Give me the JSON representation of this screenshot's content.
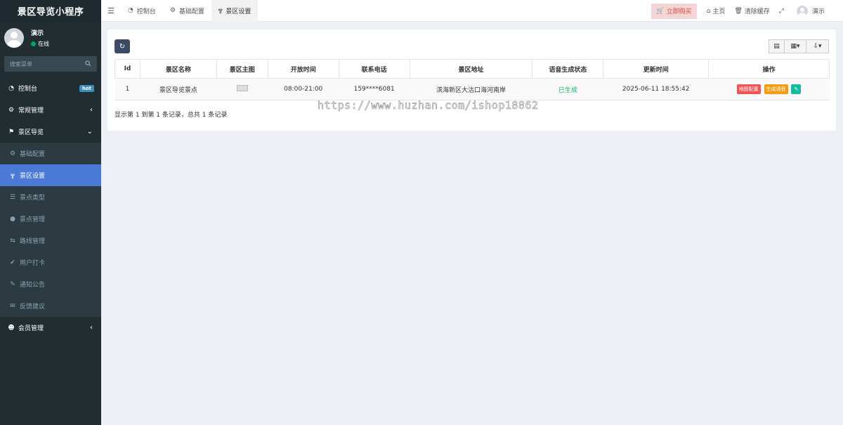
{
  "app": {
    "title": "景区导览小程序"
  },
  "user": {
    "name": "演示",
    "status": "在线"
  },
  "sidebar": {
    "search_placeholder": "搜索菜单",
    "items": [
      {
        "label": "控制台",
        "icon": "dashboard-icon",
        "badge": "hot"
      },
      {
        "label": "常规管理",
        "icon": "cogs-icon"
      },
      {
        "label": "景区导览",
        "icon": "flag-icon"
      },
      {
        "label": "会员管理",
        "icon": "user-circle-icon"
      }
    ],
    "sub_items": [
      {
        "label": "基础配置",
        "icon": "gear-icon"
      },
      {
        "label": "景区设置",
        "icon": "signpost-icon"
      },
      {
        "label": "景点类型",
        "icon": "list-icon"
      },
      {
        "label": "景点管理",
        "icon": "map-marker-icon"
      },
      {
        "label": "路线管理",
        "icon": "route-icon"
      },
      {
        "label": "用户打卡",
        "icon": "check-icon"
      },
      {
        "label": "通知公告",
        "icon": "edit-icon"
      },
      {
        "label": "反馈建议",
        "icon": "envelope-icon"
      }
    ]
  },
  "header": {
    "tabs": [
      {
        "label": "控制台",
        "icon": "dashboard-icon"
      },
      {
        "label": "基础配置",
        "icon": "gear-icon"
      },
      {
        "label": "景区设置",
        "icon": "signpost-icon"
      }
    ],
    "buy_label": "立即购买",
    "home_label": "主页",
    "clear_cache_label": "清除缓存",
    "user_label": "演示"
  },
  "table": {
    "columns": [
      "Id",
      "景区名称",
      "景区主图",
      "开放时间",
      "联系电话",
      "景区地址",
      "语音生成状态",
      "更新时间",
      "操作"
    ],
    "rows": [
      {
        "id": "1",
        "name": "景区导览景点",
        "open_time": "08:00-21:00",
        "phone": "159****6081",
        "address": "滨海新区大沽口海河南岸",
        "voice_status": "已生成",
        "updated": "2025-06-11 18:55:42",
        "actions": [
          "地图配置",
          "生成语音"
        ]
      }
    ],
    "pager_text": "显示第 1 到第 1 条记录，总共 1 条记录"
  },
  "watermark": {
    "url": "https://www.huzhan.com/ishop18862"
  },
  "colors": {
    "sidebar": "#222d32",
    "active": "#4a7ad6",
    "status_green": "#18b566",
    "btn_red": "#f25353",
    "btn_orange": "#f39c12",
    "btn_teal": "#18bc9c"
  }
}
